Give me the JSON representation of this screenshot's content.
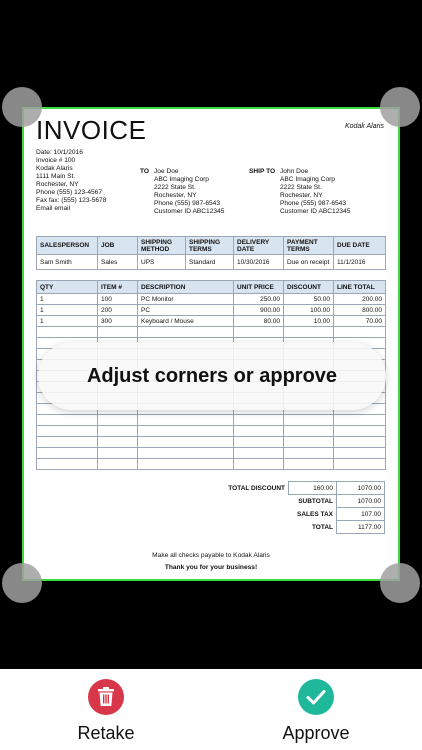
{
  "invoice": {
    "title": "INVOICE",
    "brand": "Kodak Alaris",
    "date": "Date: 10/1/2016",
    "number": "Invoice # 100",
    "from": [
      "Kodak Alaris",
      "1111 Main St.",
      "Rochester, NY",
      "Phone (555) 123-4567",
      "Fax fax: (555) 123-5678",
      "Email email"
    ],
    "to_label": "TO",
    "to": [
      "Joe Doe",
      "ABC Imaging Corp",
      "2222 State St.",
      "Rochester, NY",
      "Phone (555) 987-6543",
      "Customer ID ABC12345"
    ],
    "ship_label": "SHIP TO",
    "ship_to": [
      "John Doe",
      "ABC Imaging Corp",
      "2222 State St.",
      "Rochester, NY",
      "Phone (555) 987-6543",
      "Customer ID ABC12345"
    ],
    "sales_headers": [
      "SALESPERSON",
      "JOB",
      "SHIPPING METHOD",
      "SHIPPING TERMS",
      "DELIVERY DATE",
      "PAYMENT TERMS",
      "DUE DATE"
    ],
    "sales_row": [
      "Sam Smith",
      "Sales",
      "UPS",
      "Standard",
      "10/30/2016",
      "Due on receipt",
      "11/1/2016"
    ],
    "item_headers": [
      "QTY",
      "ITEM #",
      "DESCRIPTION",
      "UNIT PRICE",
      "DISCOUNT",
      "LINE TOTAL"
    ],
    "items": [
      [
        "1",
        "100",
        "PC Monitor",
        "250.00",
        "50.00",
        "200.00"
      ],
      [
        "1",
        "200",
        "PC",
        "900.00",
        "100.00",
        "800.00"
      ],
      [
        "1",
        "300",
        "Keyboard / Mouse",
        "80.00",
        "10.00",
        "70.00"
      ]
    ],
    "totals": {
      "total_discount_label": "TOTAL DISCOUNT",
      "total_discount": "160.00",
      "discount_line_total": "1070.00",
      "subtotal_label": "SUBTOTAL",
      "subtotal": "1070.00",
      "sales_tax_label": "SALES TAX",
      "sales_tax": "107.00",
      "total_label": "TOTAL",
      "total": "1177.00"
    },
    "payable_note": "Make all checks payable to Kodak Alaris",
    "thanks": "Thank you for your business!"
  },
  "overlay": {
    "message": "Adjust corners or approve"
  },
  "actions": {
    "retake_label": "Retake",
    "approve_label": "Approve"
  },
  "colors": {
    "frame": "#3ddc3d",
    "retake": "#d8374a",
    "approve": "#1fb89a"
  }
}
